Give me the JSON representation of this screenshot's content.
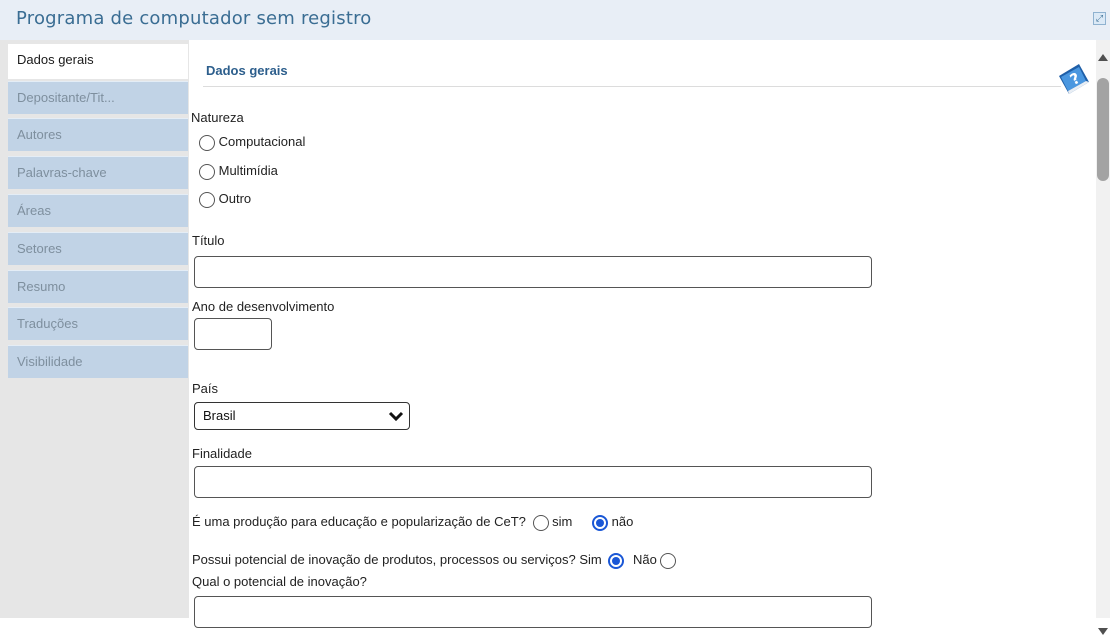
{
  "window": {
    "title": "Programa de computador sem registro"
  },
  "sidebar": {
    "tabs": [
      {
        "label": "Dados gerais",
        "active": true
      },
      {
        "label": "Depositante/Tit..."
      },
      {
        "label": "Autores"
      },
      {
        "label": "Palavras-chave"
      },
      {
        "label": "Áreas"
      },
      {
        "label": "Setores"
      },
      {
        "label": "Resumo"
      },
      {
        "label": "Traduções"
      },
      {
        "label": "Visibilidade"
      }
    ]
  },
  "form": {
    "section_title": "Dados gerais",
    "natureza": {
      "label": "Natureza",
      "options": [
        "Computacional",
        "Multimídia",
        "Outro"
      ],
      "selected": null
    },
    "titulo": {
      "label": "Título",
      "value": ""
    },
    "ano": {
      "label": "Ano de desenvolvimento",
      "value": ""
    },
    "pais": {
      "label": "País",
      "value": "Brasil"
    },
    "finalidade": {
      "label": "Finalidade",
      "value": ""
    },
    "educacao": {
      "question": "É uma produção para educação e popularização de CeT?",
      "sim_label": "sim",
      "nao_label": "não",
      "selected": "não"
    },
    "inovacao": {
      "question": "Possui potencial de inovação de produtos, processos ou serviços?",
      "sim_label": "Sim",
      "nao_label": "Não",
      "selected": "Sim"
    },
    "potencial": {
      "label": "Qual o potencial de inovação?",
      "value": ""
    }
  },
  "colors": {
    "title": "#3a6d93",
    "tab": "#c1d3e6",
    "radio_checked": "#1a57d6"
  },
  "icons": {
    "help": "help-book-icon",
    "maximize": "maximize-icon",
    "select": "chevron-down-icon"
  }
}
